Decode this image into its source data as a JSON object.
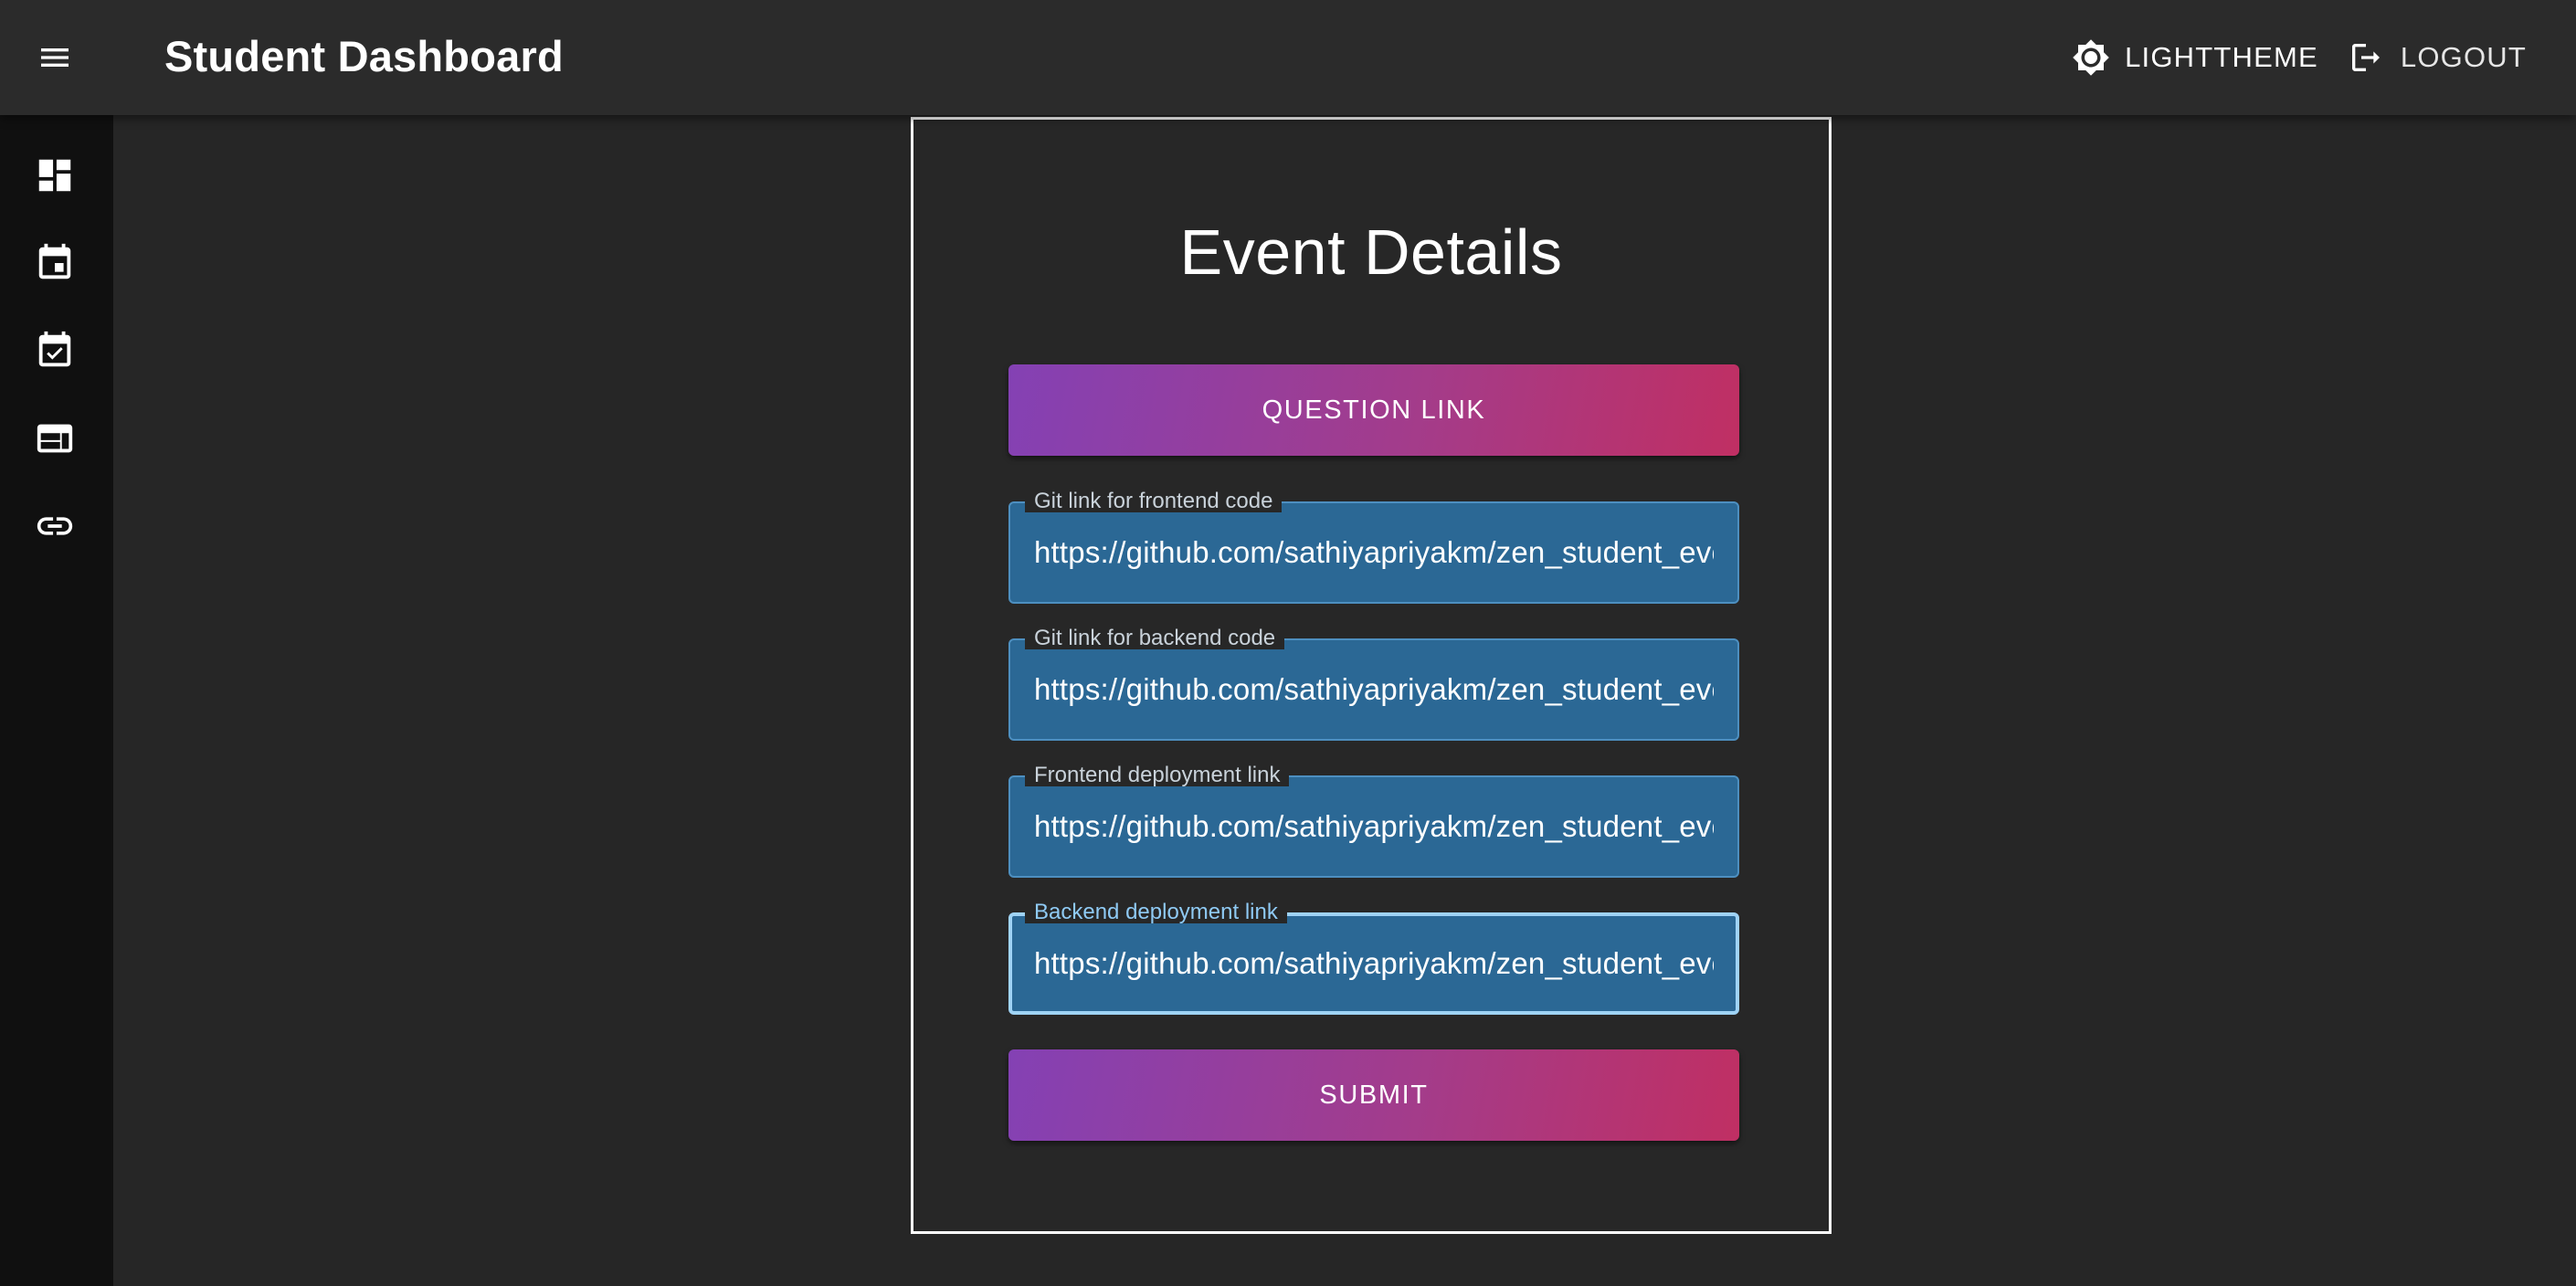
{
  "header": {
    "title": "Student Dashboard",
    "theme_label": "LIGHTTHEME",
    "logout_label": "LOGOUT"
  },
  "sidebar": {
    "items": [
      {
        "icon": "dashboard-icon"
      },
      {
        "icon": "calendar-event-icon"
      },
      {
        "icon": "calendar-check-icon"
      },
      {
        "icon": "web-icon"
      },
      {
        "icon": "link-icon"
      }
    ]
  },
  "main": {
    "title": "Event Details",
    "question_link_label": "QUESTION LINK",
    "fields": [
      {
        "label": "Git link for frontend code",
        "value": "https://github.com/sathiyapriyakm/zen_student_event"
      },
      {
        "label": "Git link for backend code",
        "value": "https://github.com/sathiyapriyakm/zen_student_event"
      },
      {
        "label": "Frontend deployment link",
        "value": "https://github.com/sathiyapriyakm/zen_student_event"
      },
      {
        "label": "Backend deployment link",
        "value": "https://github.com/sathiyapriyakm/zen_student_event"
      }
    ],
    "submit_label": "SUBMIT"
  },
  "colors": {
    "background": "#262626",
    "appbar": "#2b2b2b",
    "sidebar": "#101010",
    "field_fill": "#2b6895",
    "focus_border": "#9fd3f6",
    "gradient_start": "#8441b4",
    "gradient_end": "#c02f63"
  }
}
